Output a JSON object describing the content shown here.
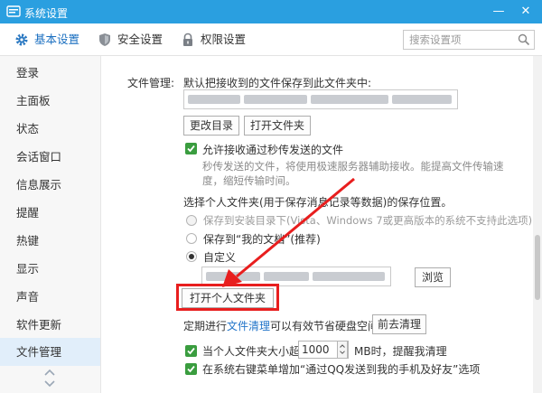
{
  "window": {
    "title": "系统设置",
    "min_glyph": "—",
    "close_glyph": "✕"
  },
  "toolbar": {
    "tabs": [
      {
        "label": "基本设置",
        "icon": "gear-icon"
      },
      {
        "label": "安全设置",
        "icon": "shield-icon"
      },
      {
        "label": "权限设置",
        "icon": "lock-icon"
      }
    ],
    "search_placeholder": "搜索设置项"
  },
  "sidebar": {
    "items": [
      "登录",
      "主面板",
      "状态",
      "会话窗口",
      "信息展示",
      "提醒",
      "热键",
      "显示",
      "声音",
      "软件更新",
      "文件管理"
    ],
    "active_index": 10
  },
  "file_management": {
    "section_label": "文件管理:",
    "default_save_label": "默认把接收到的文件保存到此文件夹中:",
    "change_dir_button": "更改目录",
    "open_folder_button": "打开文件夹",
    "allow_instant_label": "允许接收通过秒传发送的文件",
    "allow_instant_desc_1": "秒传发送的文件，将使用极速服务器辅助接收。能提高文件传输速",
    "allow_instant_desc_2": "度，缩短传输时间。",
    "personal_folder_prompt": "选择个人文件夹(用于保存消息记录等数据)的保存位置。",
    "radio_install_dir": "保存到安装目录下(Vista、Windows 7或更高版本的系统不支持此选项)",
    "radio_my_docs": "保存到“我的文档”(推荐)",
    "radio_custom": "自定义",
    "browse_button": "浏览",
    "open_personal_folder_button": "打开个人文件夹",
    "cleanup_text_prefix": "定期进行",
    "cleanup_link": "文件清理",
    "cleanup_text_suffix": "可以有效节省硬盘空间。",
    "cleanup_button": "前去清理",
    "size_warn_prefix": "当个人文件夹大小超过",
    "size_value": "1000",
    "size_warn_suffix": "MB时，提醒我清理",
    "context_menu_label": "在系统右键菜单增加“通过QQ发送到我的手机及好友”选项"
  },
  "colors": {
    "titlebar": "#2a9fe0",
    "checkbox": "#3a9d3f",
    "annotation": "#e81e1e",
    "link": "#2174c9"
  }
}
